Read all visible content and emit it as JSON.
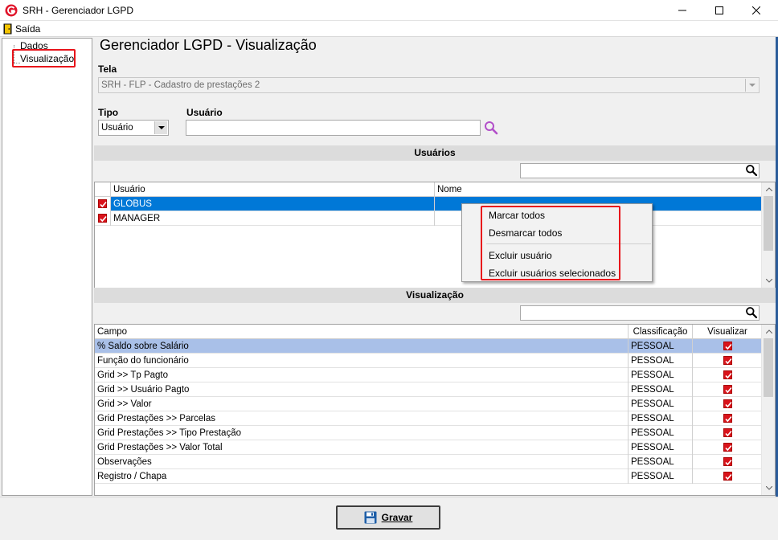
{
  "window": {
    "title": "SRH - Gerenciador LGPD",
    "minimize": "–",
    "maximize": "☐",
    "close": "✕"
  },
  "menu": {
    "exit_label": "Saída"
  },
  "sidebar": {
    "items": [
      {
        "label": "Dados"
      },
      {
        "label": "Visualização"
      }
    ]
  },
  "page": {
    "title": "Gerenciador LGPD - Visualização"
  },
  "form": {
    "tela_label": "Tela",
    "tela_value": "SRH - FLP - Cadastro de prestações 2",
    "tipo_label": "Tipo",
    "tipo_value": "Usuário",
    "usuario_label": "Usuário",
    "usuario_value": ""
  },
  "usuarios": {
    "header": "Usuários",
    "filter_value": "",
    "columns": [
      "Usuário",
      "Nome"
    ],
    "rows": [
      {
        "user": "GLOBUS",
        "name": "",
        "checked": true,
        "selected": true
      },
      {
        "user": "MANAGER",
        "name": "",
        "checked": true,
        "selected": false
      }
    ]
  },
  "context_menu": {
    "items": [
      "Marcar todos",
      "Desmarcar todos",
      "Excluir usuário",
      "Excluir usuários selecionados"
    ]
  },
  "visualizacao": {
    "header": "Visualização",
    "filter_value": "",
    "columns": [
      "Campo",
      "Classificação",
      "Visualizar"
    ],
    "rows": [
      {
        "campo": "% Saldo sobre Salário",
        "classificacao": "PESSOAL",
        "visualizar": true,
        "selected": true
      },
      {
        "campo": "Função do funcionário",
        "classificacao": "PESSOAL",
        "visualizar": true
      },
      {
        "campo": "Grid >> Tp Pagto",
        "classificacao": "PESSOAL",
        "visualizar": true
      },
      {
        "campo": "Grid >> Usuário Pagto",
        "classificacao": "PESSOAL",
        "visualizar": true
      },
      {
        "campo": "Grid >> Valor",
        "classificacao": "PESSOAL",
        "visualizar": true
      },
      {
        "campo": "Grid Prestações >> Parcelas",
        "classificacao": "PESSOAL",
        "visualizar": true
      },
      {
        "campo": "Grid Prestações >> Tipo Prestação",
        "classificacao": "PESSOAL",
        "visualizar": true
      },
      {
        "campo": "Grid Prestações >> Valor Total",
        "classificacao": "PESSOAL",
        "visualizar": true
      },
      {
        "campo": "Observações",
        "classificacao": "PESSOAL",
        "visualizar": true
      },
      {
        "campo": "Registro / Chapa",
        "classificacao": "PESSOAL",
        "visualizar": true
      }
    ]
  },
  "footer": {
    "save_label": "Gravar"
  },
  "colors": {
    "selection_blue": "#0078d7",
    "selection_light": "#a9c0e8",
    "highlight_red": "#e8141b",
    "search_icon": "#b24fc9"
  }
}
